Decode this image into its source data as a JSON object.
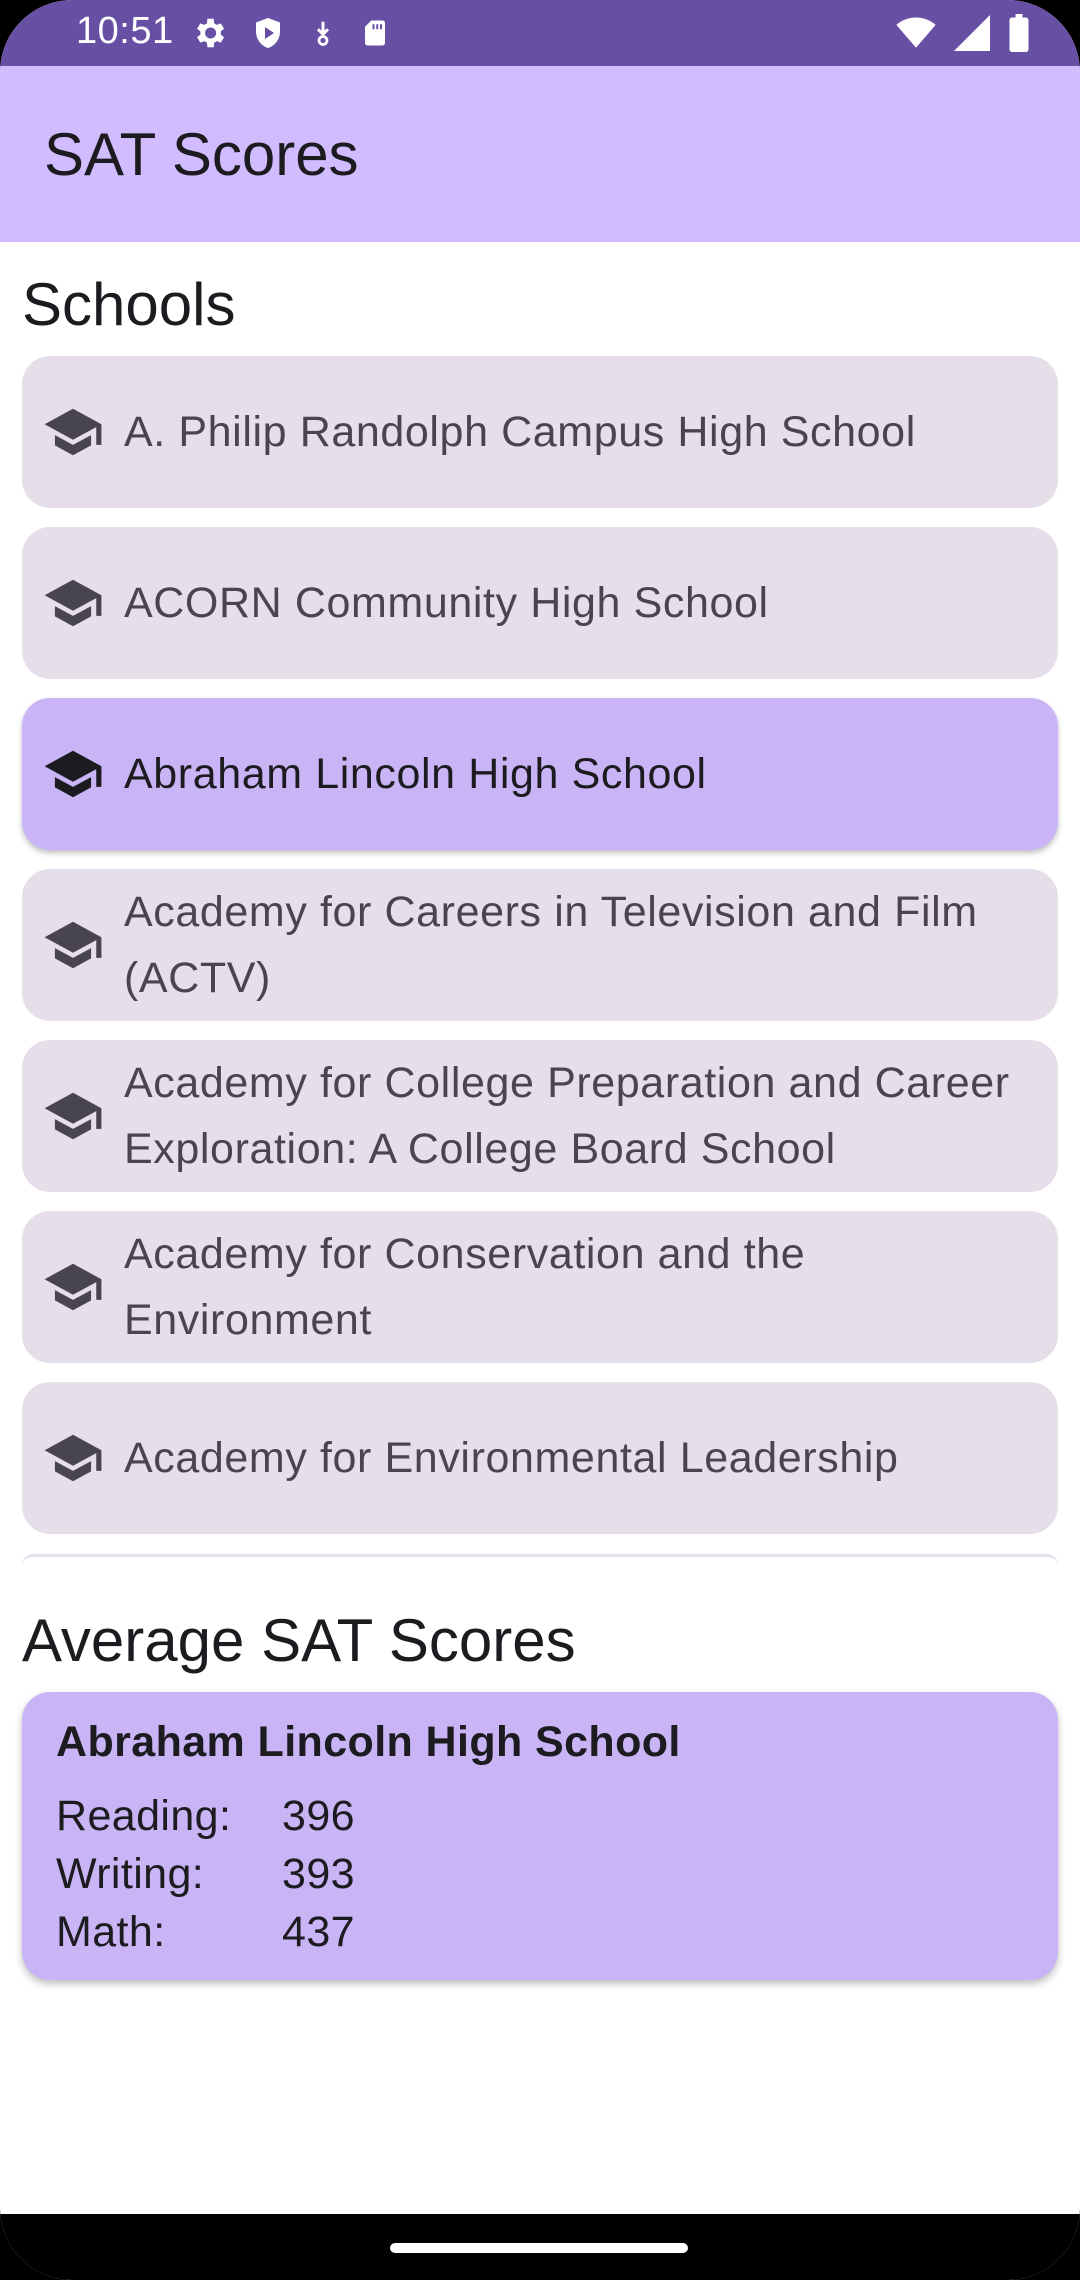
{
  "status_bar": {
    "time": "10:51",
    "left_icons": [
      "gear-icon",
      "shield-icon",
      "download-icon",
      "sd-card-icon"
    ],
    "right_icons": [
      "wifi-icon",
      "signal-icon",
      "battery-icon"
    ],
    "color": "#6750a4"
  },
  "app_bar": {
    "title": "SAT Scores",
    "color": "#d0bcff"
  },
  "schools_section": {
    "title": "Schools",
    "items": [
      {
        "name": "A. Philip Randolph Campus High School",
        "selected": false
      },
      {
        "name": "ACORN Community High School",
        "selected": false
      },
      {
        "name": "Abraham Lincoln High School",
        "selected": true
      },
      {
        "name": "Academy for Careers in Television and Film (ACTV)",
        "selected": false
      },
      {
        "name": "Academy for College Preparation and Career Exploration: A College Board School",
        "selected": false
      },
      {
        "name": "Academy for Conservation and the Environment",
        "selected": false
      },
      {
        "name": "Academy for Environmental Leadership",
        "selected": false
      }
    ],
    "item_icon": "school-icon",
    "item_color": "#e6dfea",
    "selected_color": "#c9b5f6"
  },
  "scores_section": {
    "title": "Average SAT Scores",
    "school": "Abraham Lincoln High School",
    "rows": [
      {
        "label": "Reading:",
        "value": "396"
      },
      {
        "label": "Writing:",
        "value": "393"
      },
      {
        "label": "Math:",
        "value": "437"
      }
    ]
  }
}
